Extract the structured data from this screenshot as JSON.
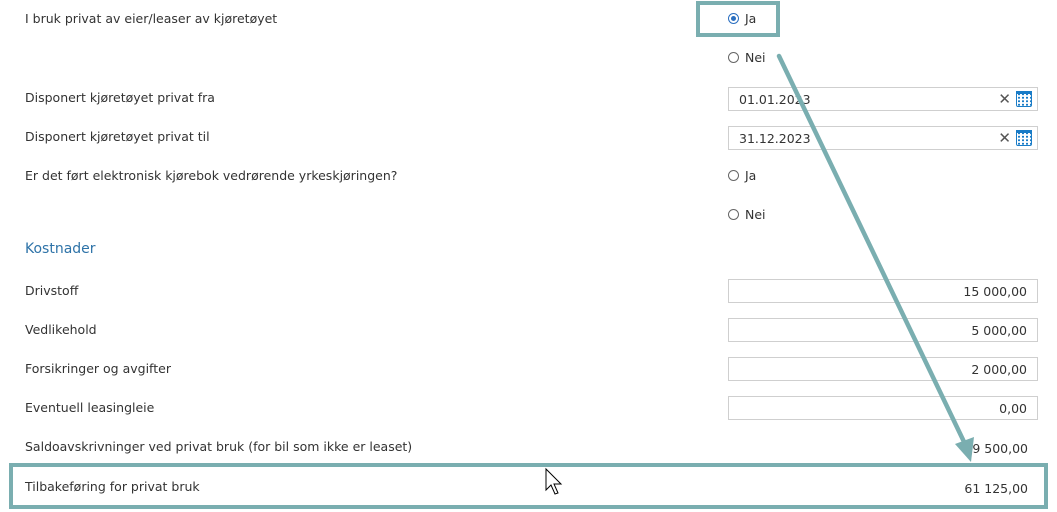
{
  "form": {
    "private_use_label": "I bruk privat av eier/leaser av kjøretøyet",
    "private_use_yes": "Ja",
    "private_use_no": "Nei",
    "from_label": "Disponert kjøretøyet privat fra",
    "from_value": "01.01.2023",
    "to_label": "Disponert kjøretøyet privat til",
    "to_value": "31.12.2023",
    "logbook_label": "Er det ført elektronisk kjørebok vedrørende yrkeskjøringen?",
    "logbook_yes": "Ja",
    "logbook_no": "Nei"
  },
  "costs": {
    "section_title": "Kostnader",
    "fuel_label": "Drivstoff",
    "fuel_value": "15 000,00",
    "maintenance_label": "Vedlikehold",
    "maintenance_value": "5 000,00",
    "insurance_label": "Forsikringer og avgifter",
    "insurance_value": "2 000,00",
    "leasing_label": "Eventuell leasingleie",
    "leasing_value": "0,00",
    "depreciation_label": "Saldoavskrivninger ved privat bruk (for bil som ikke er leaset)",
    "depreciation_value": "59 500,00",
    "reversal_label": "Tilbakeføring for privat bruk",
    "reversal_value": "61 125,00"
  },
  "selected": {
    "private_use": "Ja",
    "logbook": null
  },
  "colors": {
    "accent": "#2e73a8",
    "highlight": "#7aaeb0",
    "calendar": "#1a7cc7"
  },
  "icons": [
    "clear-icon",
    "calendar-icon",
    "mouse-cursor-icon",
    "arrow-icon"
  ]
}
